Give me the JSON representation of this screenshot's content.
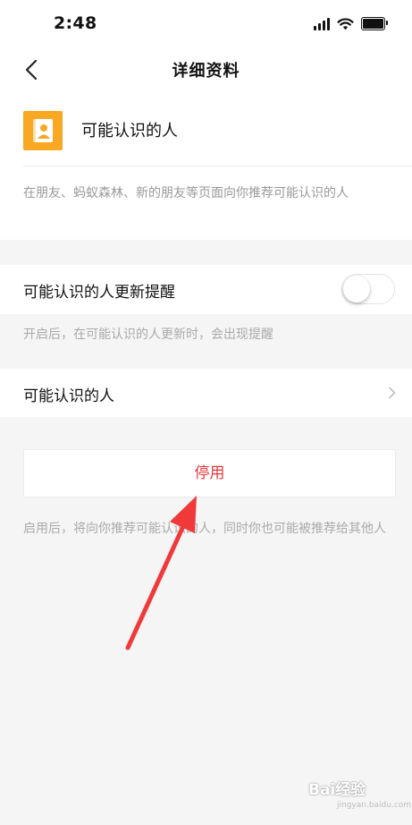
{
  "status_bar": {
    "time": "2:48"
  },
  "nav": {
    "title": "详细资料",
    "back_icon": "chevron-left-icon"
  },
  "feature": {
    "icon": "contact-card-icon",
    "icon_color": "#f8a823",
    "title": "可能认识的人",
    "description": "在朋友、蚂蚁森林、新的朋友等页面向你推荐可能认识的人"
  },
  "update_reminder": {
    "label": "可能认识的人更新提醒",
    "enabled": false,
    "hint": "开启后，在可能认识的人更新时，会出现提醒"
  },
  "people_row": {
    "label": "可能认识的人",
    "chevron_icon": "chevron-right-icon"
  },
  "disable": {
    "label": "停用",
    "color": "#e4393c",
    "hint": "启用后，将向你推荐可能认识的人，同时你也可能被推荐给其他人"
  },
  "watermark": {
    "text": "Bai经验",
    "sub": "jingyan.baidu.com"
  }
}
